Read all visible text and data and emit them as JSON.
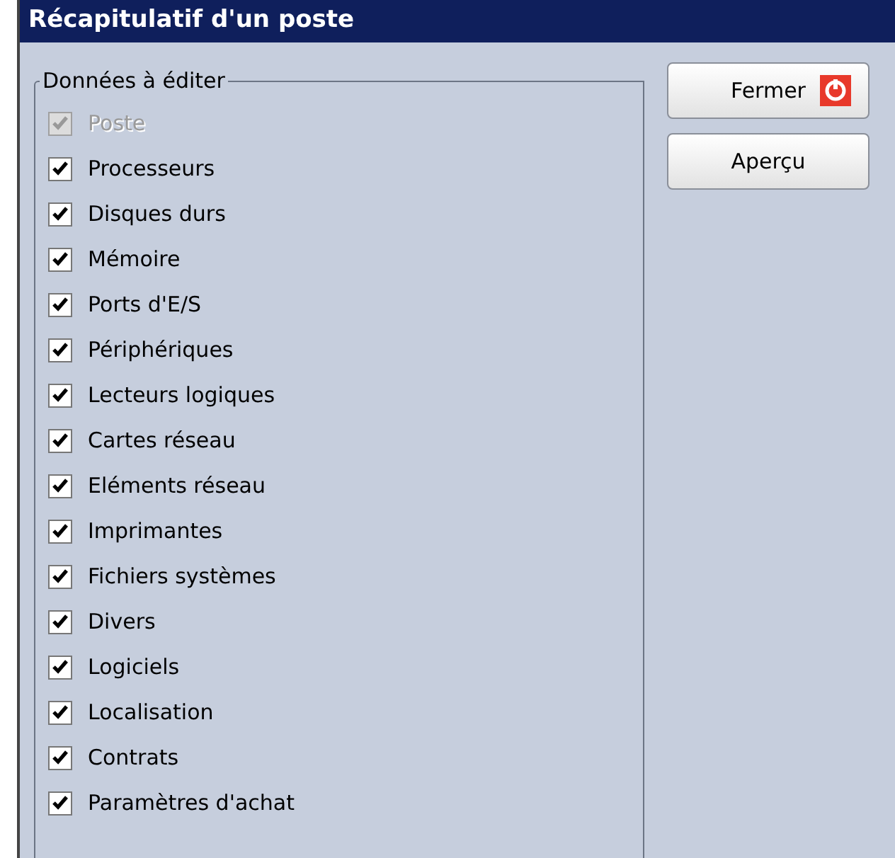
{
  "window": {
    "title": "Récapitulatif d'un poste"
  },
  "group": {
    "label": "Données à éditer",
    "items": [
      {
        "label": "Poste",
        "checked": true,
        "disabled": true
      },
      {
        "label": "Processeurs",
        "checked": true,
        "disabled": false
      },
      {
        "label": "Disques durs",
        "checked": true,
        "disabled": false
      },
      {
        "label": "Mémoire",
        "checked": true,
        "disabled": false
      },
      {
        "label": "Ports d'E/S",
        "checked": true,
        "disabled": false
      },
      {
        "label": "Périphériques",
        "checked": true,
        "disabled": false
      },
      {
        "label": "Lecteurs logiques",
        "checked": true,
        "disabled": false
      },
      {
        "label": "Cartes réseau",
        "checked": true,
        "disabled": false
      },
      {
        "label": "Eléments réseau",
        "checked": true,
        "disabled": false
      },
      {
        "label": "Imprimantes",
        "checked": true,
        "disabled": false
      },
      {
        "label": "Fichiers systèmes",
        "checked": true,
        "disabled": false
      },
      {
        "label": "Divers",
        "checked": true,
        "disabled": false
      },
      {
        "label": "Logiciels",
        "checked": true,
        "disabled": false
      },
      {
        "label": "Localisation",
        "checked": true,
        "disabled": false
      },
      {
        "label": "Contrats",
        "checked": true,
        "disabled": false
      },
      {
        "label": "Paramètres d'achat",
        "checked": true,
        "disabled": false
      }
    ]
  },
  "buttons": [
    {
      "label": "Fermer",
      "kind": "close"
    },
    {
      "label": "Aperçu",
      "kind": "plain"
    }
  ]
}
